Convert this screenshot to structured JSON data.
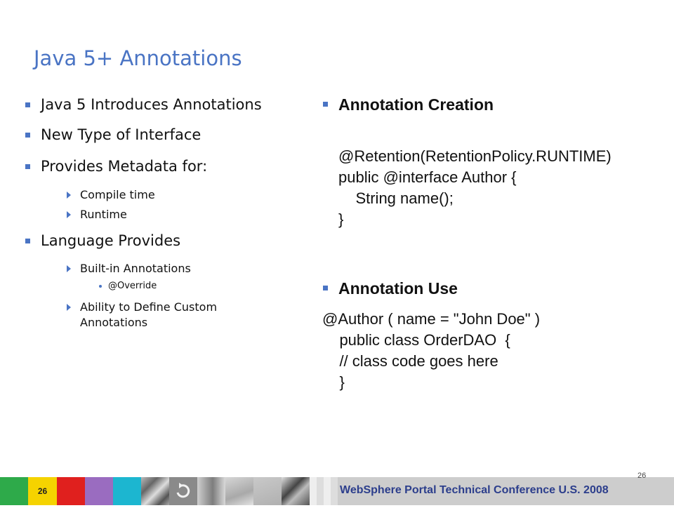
{
  "slide": {
    "title": "Java 5+ Annotations",
    "left": {
      "item1": "Java 5 Introduces Annotations",
      "item2": "New Type of Interface",
      "item3": "Provides Metadata for:",
      "item3_sub1": "Compile time",
      "item3_sub2": "Runtime",
      "item4": "Language Provides",
      "item4_sub1": "Built-in Annotations",
      "item4_sub1_sub1": "@Override",
      "item4_sub2": "Ability to Define Custom Annotations"
    },
    "right": {
      "heading1": "Annotation Creation",
      "code1": "@Retention(RetentionPolicy.RUNTIME)\npublic @interface Author {\n    String name();\n}",
      "heading2": "Annotation Use",
      "code2": "@Author ( name = \"John Doe\" )\n    public class OrderDAO  {\n    // class code goes here\n    }"
    }
  },
  "footer": {
    "page_number": "26",
    "page_number_overlay": "26",
    "conference": "WebSphere Portal Technical Conference U.S. 2008"
  },
  "colors": {
    "title": "#4a74c4",
    "bullet": "#4a74c4",
    "footer_green": "#2eaa4a",
    "footer_yellow": "#f5d300",
    "footer_red": "#e0201e",
    "footer_purple": "#9a6cc0",
    "footer_cyan": "#1cb6d0",
    "footer_text": "#2c3e8c"
  }
}
